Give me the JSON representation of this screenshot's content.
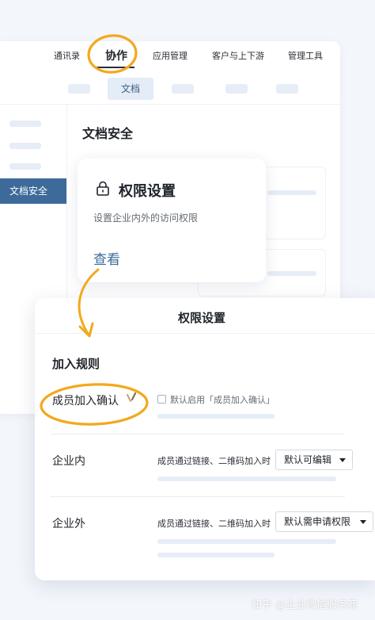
{
  "top_nav": {
    "items": [
      "通讯录",
      "协作",
      "应用管理",
      "客户与上下游",
      "管理工具"
    ],
    "active": "协作"
  },
  "sub_nav": {
    "active_tab": "文档"
  },
  "sidebar": {
    "active_item": "文档安全"
  },
  "section": {
    "title": "文档安全"
  },
  "permission_card": {
    "title": "权限设置",
    "description": "设置企业内外的访问权限",
    "link": "查看",
    "icon": "lock-icon"
  },
  "dialog": {
    "title": "权限设置",
    "join_rules_title": "加入规则",
    "member_confirm": {
      "label": "成员加入确认",
      "checkbox_label": "默认启用「成员加入确认」",
      "checked": false
    },
    "internal": {
      "label": "企业内",
      "description": "成员通过链接、二维码加入时",
      "select_value": "默认可编辑"
    },
    "external": {
      "label": "企业外",
      "description": "成员通过链接、二维码加入时",
      "select_value": "默认需申请权限"
    }
  },
  "watermark": "知乎 @企业微信服务商",
  "colors": {
    "accent": "#3d6a9a",
    "highlight_circle": "#f2a91c",
    "background": "#f3f6fb",
    "placeholder": "#e6edf7"
  }
}
